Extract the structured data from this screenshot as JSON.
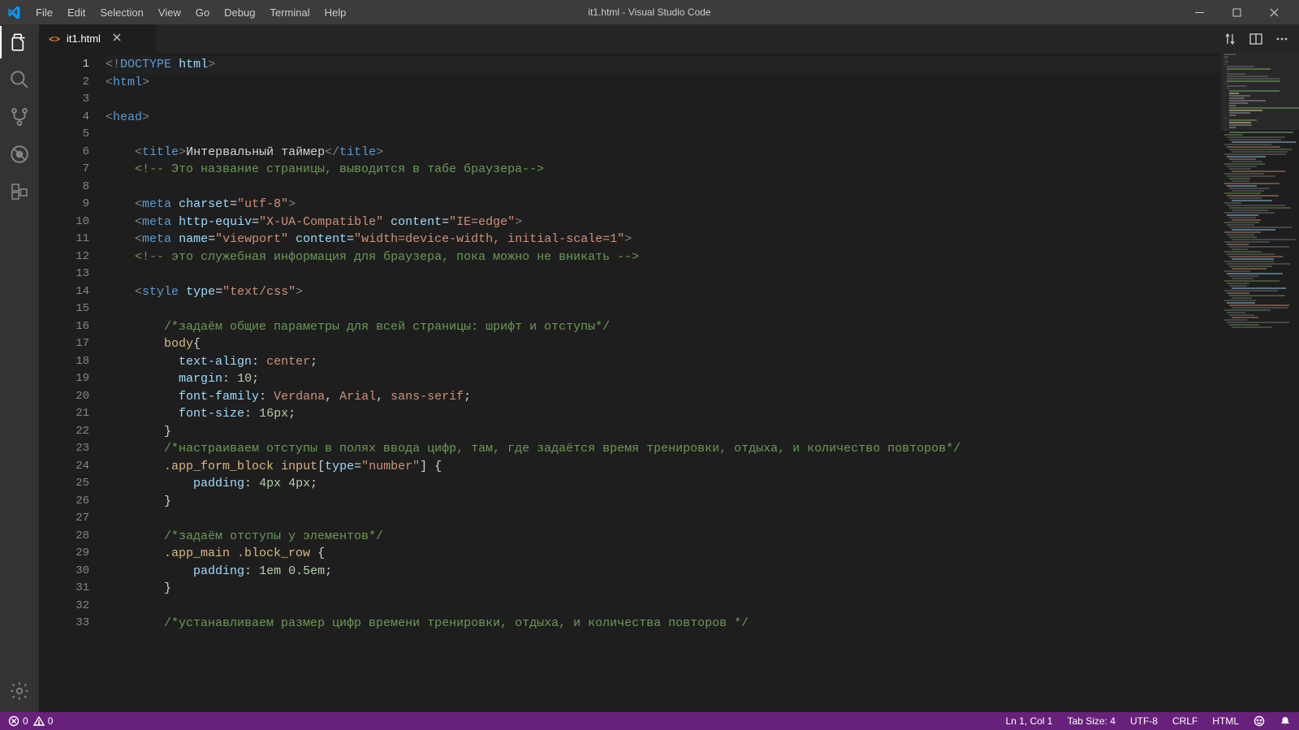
{
  "window": {
    "title": "it1.html - Visual Studio Code"
  },
  "menu": {
    "file": "File",
    "edit": "Edit",
    "selection": "Selection",
    "view": "View",
    "go": "Go",
    "debug": "Debug",
    "terminal": "Terminal",
    "help": "Help"
  },
  "tabs": {
    "t0": {
      "label": "it1.html"
    }
  },
  "status": {
    "errors": "0",
    "warnings": "0",
    "lncol": "Ln 1, Col 1",
    "tabsize": "Tab Size: 4",
    "encoding": "UTF-8",
    "eol": "CRLF",
    "lang": "HTML"
  },
  "code": {
    "lines": [
      {
        "n": 1,
        "seg": [
          [
            "t-pun",
            "<"
          ],
          [
            "t-pun",
            "!"
          ],
          [
            "t-tag",
            "DOCTYPE"
          ],
          [
            "t-plain",
            " "
          ],
          [
            "t-attr",
            "html"
          ],
          [
            "t-pun",
            ">"
          ]
        ]
      },
      {
        "n": 2,
        "seg": [
          [
            "t-pun",
            "<"
          ],
          [
            "t-tag",
            "html"
          ],
          [
            "t-pun",
            ">"
          ]
        ]
      },
      {
        "n": 3,
        "seg": []
      },
      {
        "n": 4,
        "seg": [
          [
            "t-pun",
            "<"
          ],
          [
            "t-tag",
            "head"
          ],
          [
            "t-pun",
            ">"
          ]
        ]
      },
      {
        "n": 5,
        "seg": []
      },
      {
        "n": 6,
        "indent": 1,
        "seg": [
          [
            "t-pun",
            "<"
          ],
          [
            "t-tag",
            "title"
          ],
          [
            "t-pun",
            ">"
          ],
          [
            "t-plain",
            "Интервальный таймер"
          ],
          [
            "t-pun",
            "</"
          ],
          [
            "t-tag",
            "title"
          ],
          [
            "t-pun",
            ">"
          ]
        ]
      },
      {
        "n": 7,
        "indent": 1,
        "seg": [
          [
            "t-com",
            "<!-- Это название страницы, выводится в табе браузера-->"
          ]
        ]
      },
      {
        "n": 8,
        "indent": 1,
        "seg": []
      },
      {
        "n": 9,
        "indent": 1,
        "seg": [
          [
            "t-pun",
            "<"
          ],
          [
            "t-tag",
            "meta"
          ],
          [
            "t-plain",
            " "
          ],
          [
            "t-attr",
            "charset"
          ],
          [
            "t-plain",
            "="
          ],
          [
            "t-str",
            "\"utf-8\""
          ],
          [
            "t-pun",
            ">"
          ]
        ]
      },
      {
        "n": 10,
        "indent": 1,
        "seg": [
          [
            "t-pun",
            "<"
          ],
          [
            "t-tag",
            "meta"
          ],
          [
            "t-plain",
            " "
          ],
          [
            "t-attr",
            "http-equiv"
          ],
          [
            "t-plain",
            "="
          ],
          [
            "t-str",
            "\"X-UA-Compatible\""
          ],
          [
            "t-plain",
            " "
          ],
          [
            "t-attr",
            "content"
          ],
          [
            "t-plain",
            "="
          ],
          [
            "t-str",
            "\"IE=edge\""
          ],
          [
            "t-pun",
            ">"
          ]
        ]
      },
      {
        "n": 11,
        "indent": 1,
        "seg": [
          [
            "t-pun",
            "<"
          ],
          [
            "t-tag",
            "meta"
          ],
          [
            "t-plain",
            " "
          ],
          [
            "t-attr",
            "name"
          ],
          [
            "t-plain",
            "="
          ],
          [
            "t-str",
            "\"viewport\""
          ],
          [
            "t-plain",
            " "
          ],
          [
            "t-attr",
            "content"
          ],
          [
            "t-plain",
            "="
          ],
          [
            "t-str",
            "\"width=device-width, initial-scale=1\""
          ],
          [
            "t-pun",
            ">"
          ]
        ]
      },
      {
        "n": 12,
        "indent": 1,
        "seg": [
          [
            "t-com",
            "<!-- это служебная информация для браузера, пока можно не вникать -->"
          ]
        ]
      },
      {
        "n": 13,
        "seg": []
      },
      {
        "n": 14,
        "indent": 1,
        "seg": [
          [
            "t-pun",
            "<"
          ],
          [
            "t-tag",
            "style"
          ],
          [
            "t-plain",
            " "
          ],
          [
            "t-attr",
            "type"
          ],
          [
            "t-plain",
            "="
          ],
          [
            "t-str",
            "\"text/css\""
          ],
          [
            "t-pun",
            ">"
          ]
        ]
      },
      {
        "n": 15,
        "indent": 1,
        "seg": []
      },
      {
        "n": 16,
        "indent": 2,
        "seg": [
          [
            "t-com",
            "/*задаём общие параметры для всей страницы: шрифт и отступы*/"
          ]
        ]
      },
      {
        "n": 17,
        "indent": 2,
        "seg": [
          [
            "t-sel",
            "body"
          ],
          [
            "t-brace",
            "{"
          ]
        ]
      },
      {
        "n": 18,
        "indent": 2,
        "seg": [
          [
            "t-plain",
            "  "
          ],
          [
            "t-prop",
            "text-align"
          ],
          [
            "t-plain",
            ": "
          ],
          [
            "t-str",
            "center"
          ],
          [
            "t-plain",
            ";"
          ]
        ]
      },
      {
        "n": 19,
        "indent": 2,
        "seg": [
          [
            "t-plain",
            "  "
          ],
          [
            "t-prop",
            "margin"
          ],
          [
            "t-plain",
            ": "
          ],
          [
            "t-num",
            "10"
          ],
          [
            "t-plain",
            ";"
          ]
        ]
      },
      {
        "n": 20,
        "indent": 2,
        "seg": [
          [
            "t-plain",
            "  "
          ],
          [
            "t-prop",
            "font-family"
          ],
          [
            "t-plain",
            ": "
          ],
          [
            "t-str",
            "Verdana"
          ],
          [
            "t-plain",
            ", "
          ],
          [
            "t-str",
            "Arial"
          ],
          [
            "t-plain",
            ", "
          ],
          [
            "t-str",
            "sans-serif"
          ],
          [
            "t-plain",
            ";"
          ]
        ]
      },
      {
        "n": 21,
        "indent": 2,
        "seg": [
          [
            "t-plain",
            "  "
          ],
          [
            "t-prop",
            "font-size"
          ],
          [
            "t-plain",
            ": "
          ],
          [
            "t-num",
            "16px"
          ],
          [
            "t-plain",
            ";"
          ]
        ]
      },
      {
        "n": 22,
        "indent": 2,
        "seg": [
          [
            "t-brace",
            "}"
          ]
        ]
      },
      {
        "n": 23,
        "indent": 2,
        "seg": [
          [
            "t-com",
            "/*настраиваем отступы в полях ввода цифр, там, где задаётся время тренировки, отдыха, и количество повторов*/"
          ]
        ]
      },
      {
        "n": 24,
        "indent": 2,
        "seg": [
          [
            "t-sel",
            ".app_form_block"
          ],
          [
            "t-plain",
            " "
          ],
          [
            "t-sel",
            "input"
          ],
          [
            "t-plain",
            "["
          ],
          [
            "t-attr",
            "type"
          ],
          [
            "t-plain",
            "="
          ],
          [
            "t-str",
            "\"number\""
          ],
          [
            "t-plain",
            "] "
          ],
          [
            "t-brace",
            "{"
          ]
        ]
      },
      {
        "n": 25,
        "indent": 2,
        "seg": [
          [
            "t-plain",
            "    "
          ],
          [
            "t-prop",
            "padding"
          ],
          [
            "t-plain",
            ": "
          ],
          [
            "t-num",
            "4px"
          ],
          [
            "t-plain",
            " "
          ],
          [
            "t-num",
            "4px"
          ],
          [
            "t-plain",
            ";"
          ]
        ]
      },
      {
        "n": 26,
        "indent": 2,
        "seg": [
          [
            "t-brace",
            "}"
          ]
        ]
      },
      {
        "n": 27,
        "seg": []
      },
      {
        "n": 28,
        "indent": 2,
        "seg": [
          [
            "t-com",
            "/*задаём отступы у элементов*/"
          ]
        ]
      },
      {
        "n": 29,
        "indent": 2,
        "seg": [
          [
            "t-sel",
            ".app_main"
          ],
          [
            "t-plain",
            " "
          ],
          [
            "t-sel",
            ".block_row"
          ],
          [
            "t-plain",
            " "
          ],
          [
            "t-brace",
            "{"
          ]
        ]
      },
      {
        "n": 30,
        "indent": 2,
        "seg": [
          [
            "t-plain",
            "    "
          ],
          [
            "t-prop",
            "padding"
          ],
          [
            "t-plain",
            ": "
          ],
          [
            "t-num",
            "1em"
          ],
          [
            "t-plain",
            " "
          ],
          [
            "t-num",
            "0.5em"
          ],
          [
            "t-plain",
            ";"
          ]
        ]
      },
      {
        "n": 31,
        "indent": 2,
        "seg": [
          [
            "t-brace",
            "}"
          ]
        ]
      },
      {
        "n": 32,
        "seg": []
      },
      {
        "n": 33,
        "indent": 2,
        "seg": [
          [
            "t-com",
            "/*устанавливаем размер цифр времени тренировки, отдыха, и количества повторов */"
          ]
        ]
      }
    ]
  }
}
